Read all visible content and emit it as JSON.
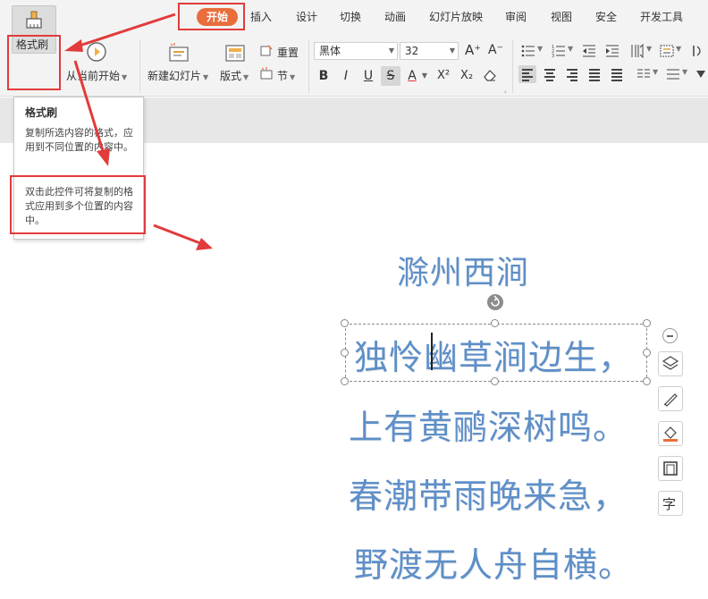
{
  "tabs": [
    {
      "label": "开始",
      "active": true
    },
    {
      "label": "插入"
    },
    {
      "label": "设计"
    },
    {
      "label": "切换"
    },
    {
      "label": "动画"
    },
    {
      "label": "幻灯片放映"
    },
    {
      "label": "审阅"
    },
    {
      "label": "视图"
    },
    {
      "label": "安全"
    },
    {
      "label": "开发工具"
    }
  ],
  "ribbon": {
    "format_brush": "格式刷",
    "from_current": "从当前开始",
    "new_slide": "新建幻灯片",
    "layout": "版式",
    "reset": "重置",
    "section": "节",
    "font_name": "黑体",
    "font_size": "32",
    "bold": "B",
    "italic": "I",
    "underline": "U",
    "strike": "S",
    "font_color": "A",
    "superscript": "X²",
    "subscript": "X₂",
    "grow_font": "A⁺",
    "shrink_font": "A⁻"
  },
  "tooltip": {
    "title": "格式刷",
    "desc": "复制所选内容的格式，应用到不同位置的内容中。",
    "hint": "双击此控件可将复制的格式应用到多个位置的内容中。"
  },
  "slide": {
    "title": "滁州西涧",
    "lines": [
      "独怜幽草涧边生，",
      "上有黄鹂深树鸣。",
      "春潮带雨晚来急，",
      "野渡无人舟自横。"
    ]
  },
  "side_tools": {
    "char": "字"
  },
  "colors": {
    "accent": "#e96e3c",
    "text_blue": "#5e8fc8",
    "annotation_red": "#e23b3b"
  }
}
